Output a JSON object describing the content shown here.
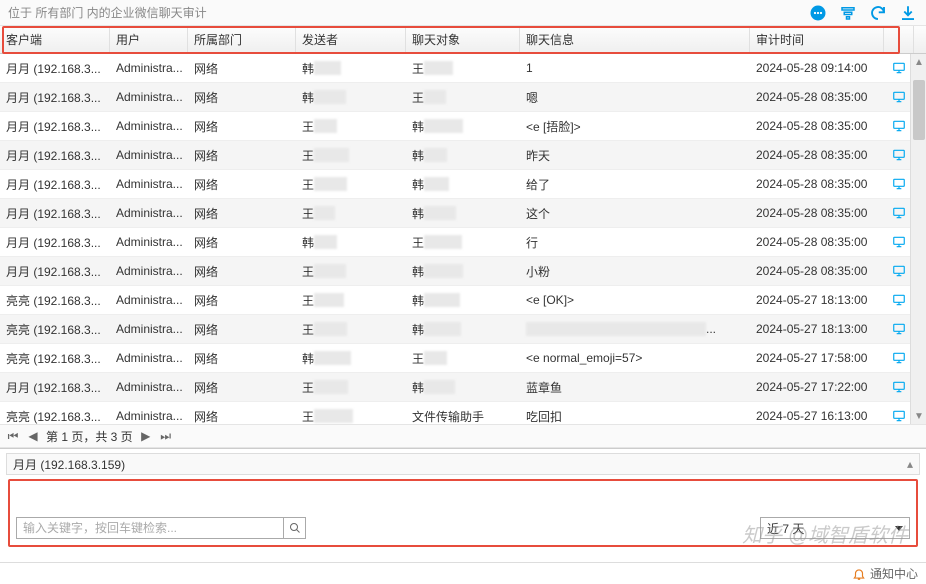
{
  "header": {
    "title": "位于 所有部门 内的企业微信聊天审计"
  },
  "columns": {
    "client": "客户端",
    "user": "用户",
    "dept": "所属部门",
    "sender": "发送者",
    "partner": "聊天对象",
    "msg": "聊天信息",
    "time": "审计时间"
  },
  "rows": [
    {
      "client": "月月 (192.168.3...",
      "user": "Administra...",
      "dept": "网络",
      "sender": "韩",
      "partner": "王",
      "msg": "1",
      "time": "2024-05-28 09:14:00"
    },
    {
      "client": "月月 (192.168.3...",
      "user": "Administra...",
      "dept": "网络",
      "sender": "韩",
      "partner": "王",
      "msg": "嗯",
      "time": "2024-05-28 08:35:00"
    },
    {
      "client": "月月 (192.168.3...",
      "user": "Administra...",
      "dept": "网络",
      "sender": "王",
      "partner": "韩",
      "msg": "<e [捂脸]>",
      "time": "2024-05-28 08:35:00"
    },
    {
      "client": "月月 (192.168.3...",
      "user": "Administra...",
      "dept": "网络",
      "sender": "王",
      "partner": "韩",
      "msg": "昨天",
      "time": "2024-05-28 08:35:00"
    },
    {
      "client": "月月 (192.168.3...",
      "user": "Administra...",
      "dept": "网络",
      "sender": "王",
      "partner": "韩",
      "msg": "给了",
      "time": "2024-05-28 08:35:00"
    },
    {
      "client": "月月 (192.168.3...",
      "user": "Administra...",
      "dept": "网络",
      "sender": "王",
      "partner": "韩",
      "msg": "这个",
      "time": "2024-05-28 08:35:00"
    },
    {
      "client": "月月 (192.168.3...",
      "user": "Administra...",
      "dept": "网络",
      "sender": "韩",
      "partner": "王",
      "msg": "行",
      "time": "2024-05-28 08:35:00"
    },
    {
      "client": "月月 (192.168.3...",
      "user": "Administra...",
      "dept": "网络",
      "sender": "王",
      "partner": "韩",
      "msg": "小粉",
      "time": "2024-05-28 08:35:00"
    },
    {
      "client": "亮亮 (192.168.3...",
      "user": "Administra...",
      "dept": "网络",
      "sender": "王",
      "partner": "韩",
      "msg": "<e [OK]>",
      "time": "2024-05-27 18:13:00"
    },
    {
      "client": "亮亮 (192.168.3...",
      "user": "Administra...",
      "dept": "网络",
      "sender": "王",
      "partner": "韩",
      "msg": "",
      "time": "2024-05-27 18:13:00",
      "redacted": true
    },
    {
      "client": "亮亮 (192.168.3...",
      "user": "Administra...",
      "dept": "网络",
      "sender": "韩",
      "partner": "王",
      "msg": "<e normal_emoji=57>",
      "time": "2024-05-27 17:58:00"
    },
    {
      "client": "月月 (192.168.3...",
      "user": "Administra...",
      "dept": "网络",
      "sender": "王",
      "partner": "韩",
      "msg": "蓝章鱼",
      "time": "2024-05-27 17:22:00"
    },
    {
      "client": "亮亮 (192.168.3...",
      "user": "Administra...",
      "dept": "网络",
      "sender": "王",
      "partner": "文件传输助手",
      "msg": "吃回扣",
      "time": "2024-05-27 16:13:00"
    }
  ],
  "pager": {
    "text": "第 1 页，共 3 页"
  },
  "detail": {
    "title": "月月 (192.168.3.159)"
  },
  "search": {
    "placeholder": "输入关键字，按回车键检索..."
  },
  "date_filter": {
    "label": "近 7 天"
  },
  "footer": {
    "notify": "通知中心"
  },
  "watermark": "知乎 @域智盾软件"
}
